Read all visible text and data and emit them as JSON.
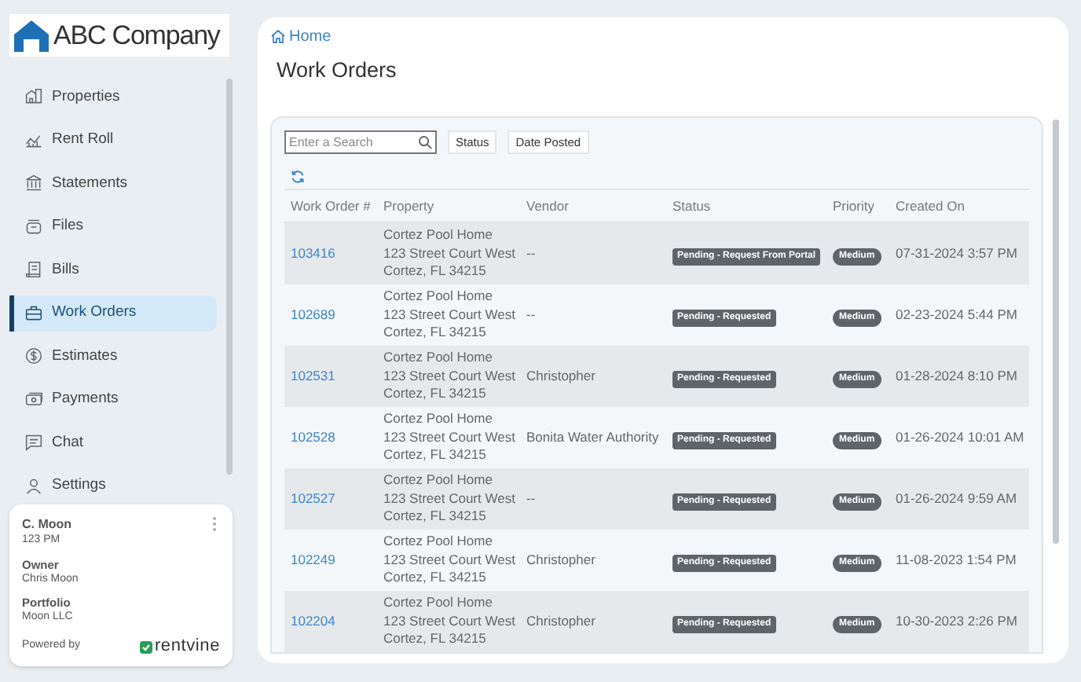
{
  "logo": {
    "text": "ABC Company"
  },
  "sidebar": {
    "items": [
      {
        "label": "Properties",
        "selected": false
      },
      {
        "label": "Rent Roll",
        "selected": false
      },
      {
        "label": "Statements",
        "selected": false
      },
      {
        "label": "Files",
        "selected": false
      },
      {
        "label": "Bills",
        "selected": false
      },
      {
        "label": "Work Orders",
        "selected": true
      },
      {
        "label": "Estimates",
        "selected": false
      },
      {
        "label": "Payments",
        "selected": false
      },
      {
        "label": "Chat",
        "selected": false
      },
      {
        "label": "Settings",
        "selected": false
      }
    ]
  },
  "account": {
    "name": "C. Moon",
    "unit": "123 PM",
    "owner_label": "Owner",
    "owner": "Chris Moon",
    "portfolio_label": "Portfolio",
    "portfolio": "Moon LLC",
    "powered_by": "Powered by",
    "brand": "rentvine"
  },
  "breadcrumb": "Home",
  "title": "Work Orders",
  "search": {
    "placeholder": "Enter a Search"
  },
  "filters": [
    "Status",
    "Date Posted"
  ],
  "table": {
    "columns": [
      "Work Order #",
      "Property",
      "Vendor",
      "Status",
      "Priority",
      "Created On"
    ],
    "rows": [
      {
        "id": "103416",
        "property": [
          "Cortez Pool Home",
          "123 Street Court West",
          "Cortez, FL 34215"
        ],
        "vendor": "--",
        "status": "Pending - Request From Portal",
        "priority": "Medium",
        "created": "07-31-2024 3:57 PM"
      },
      {
        "id": "102689",
        "property": [
          "Cortez Pool Home",
          "123 Street Court West",
          "Cortez, FL 34215"
        ],
        "vendor": "--",
        "status": "Pending - Requested",
        "priority": "Medium",
        "created": "02-23-2024 5:44 PM"
      },
      {
        "id": "102531",
        "property": [
          "Cortez Pool Home",
          "123 Street Court West",
          "Cortez, FL 34215"
        ],
        "vendor": "Christopher",
        "status": "Pending - Requested",
        "priority": "Medium",
        "created": "01-28-2024 8:10 PM"
      },
      {
        "id": "102528",
        "property": [
          "Cortez Pool Home",
          "123 Street Court West",
          "Cortez, FL 34215"
        ],
        "vendor": "Bonita Water Authority",
        "status": "Pending - Requested",
        "priority": "Medium",
        "created": "01-26-2024 10:01 AM"
      },
      {
        "id": "102527",
        "property": [
          "Cortez Pool Home",
          "123 Street Court West",
          "Cortez, FL 34215"
        ],
        "vendor": "--",
        "status": "Pending - Requested",
        "priority": "Medium",
        "created": "01-26-2024 9:59 AM"
      },
      {
        "id": "102249",
        "property": [
          "Cortez Pool Home",
          "123 Street Court West",
          "Cortez, FL 34215"
        ],
        "vendor": "Christopher",
        "status": "Pending - Requested",
        "priority": "Medium",
        "created": "11-08-2023 1:54 PM"
      },
      {
        "id": "102204",
        "property": [
          "Cortez Pool Home",
          "123 Street Court West",
          "Cortez, FL 34215"
        ],
        "vendor": "Christopher",
        "status": "Pending - Requested",
        "priority": "Medium",
        "created": "10-30-2023 2:26 PM"
      }
    ]
  }
}
